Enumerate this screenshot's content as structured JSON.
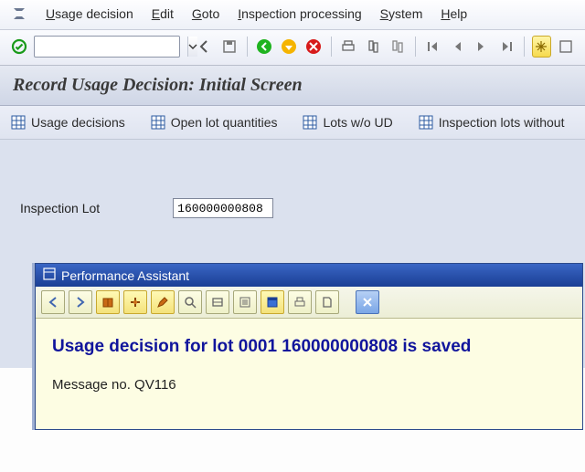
{
  "menubar": {
    "items": [
      {
        "label": "Usage decision",
        "accel": "U"
      },
      {
        "label": "Edit",
        "accel": "E"
      },
      {
        "label": "Goto",
        "accel": "G"
      },
      {
        "label": "Inspection processing",
        "accel": "I"
      },
      {
        "label": "System",
        "accel": "S"
      },
      {
        "label": "Help",
        "accel": "H"
      }
    ]
  },
  "toolbar": {
    "command_value": ""
  },
  "title": "Record Usage Decision: Initial Screen",
  "app_buttons": [
    {
      "label": "Usage decisions"
    },
    {
      "label": "Open lot quantities"
    },
    {
      "label": "Lots w/o UD"
    },
    {
      "label": "Inspection lots without"
    }
  ],
  "fields": {
    "inspection_lot": {
      "label": "Inspection Lot",
      "value": "160000000808"
    }
  },
  "assistant": {
    "title": "Performance Assistant",
    "heading": "Usage decision for lot 0001 160000000808 is saved",
    "message": "Message no. QV116"
  }
}
